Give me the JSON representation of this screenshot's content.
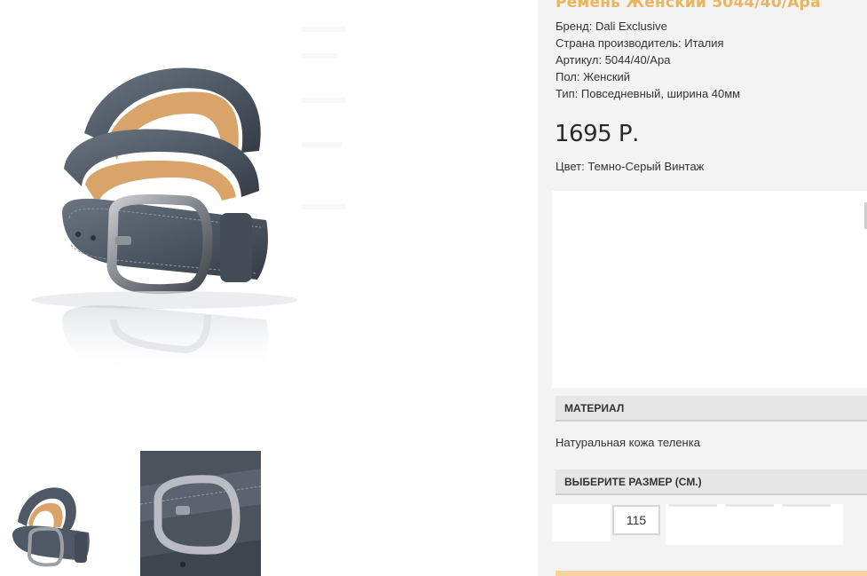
{
  "product": {
    "title": "Ремень Женский 5044/40/Ара",
    "specs": {
      "brand": "Бренд: Dali Exclusive",
      "country": "Страна производитель: Италия",
      "sku": "Артикул: 5044/40/Ара",
      "gender": "Пол: Женский",
      "type": "Тип: Повседневный, ширина 40мм"
    },
    "price": "1695 Р.",
    "color": "Цвет: Темно-Серый Винтаж"
  },
  "sections": {
    "material_header": "МАТЕРИАЛ",
    "material_value": "Натуральная кожа теленка",
    "size_header": "ВЫБЕРИТЕ РАЗМЕР (СМ.)"
  },
  "sizes": {
    "selected": "115"
  },
  "colors": {
    "title_accent": "#e9b55e",
    "panel_bg": "#f3f3f3",
    "header_bg": "#e6e6e6",
    "belt_leather": "#4e5965",
    "belt_lining": "#d9a46a",
    "buckle_metal": "#8e9299"
  },
  "gallery": {
    "main_image": "belt-photo",
    "thumbnails": [
      "belt-thumb-full",
      "belt-thumb-buckle-closeup"
    ]
  }
}
